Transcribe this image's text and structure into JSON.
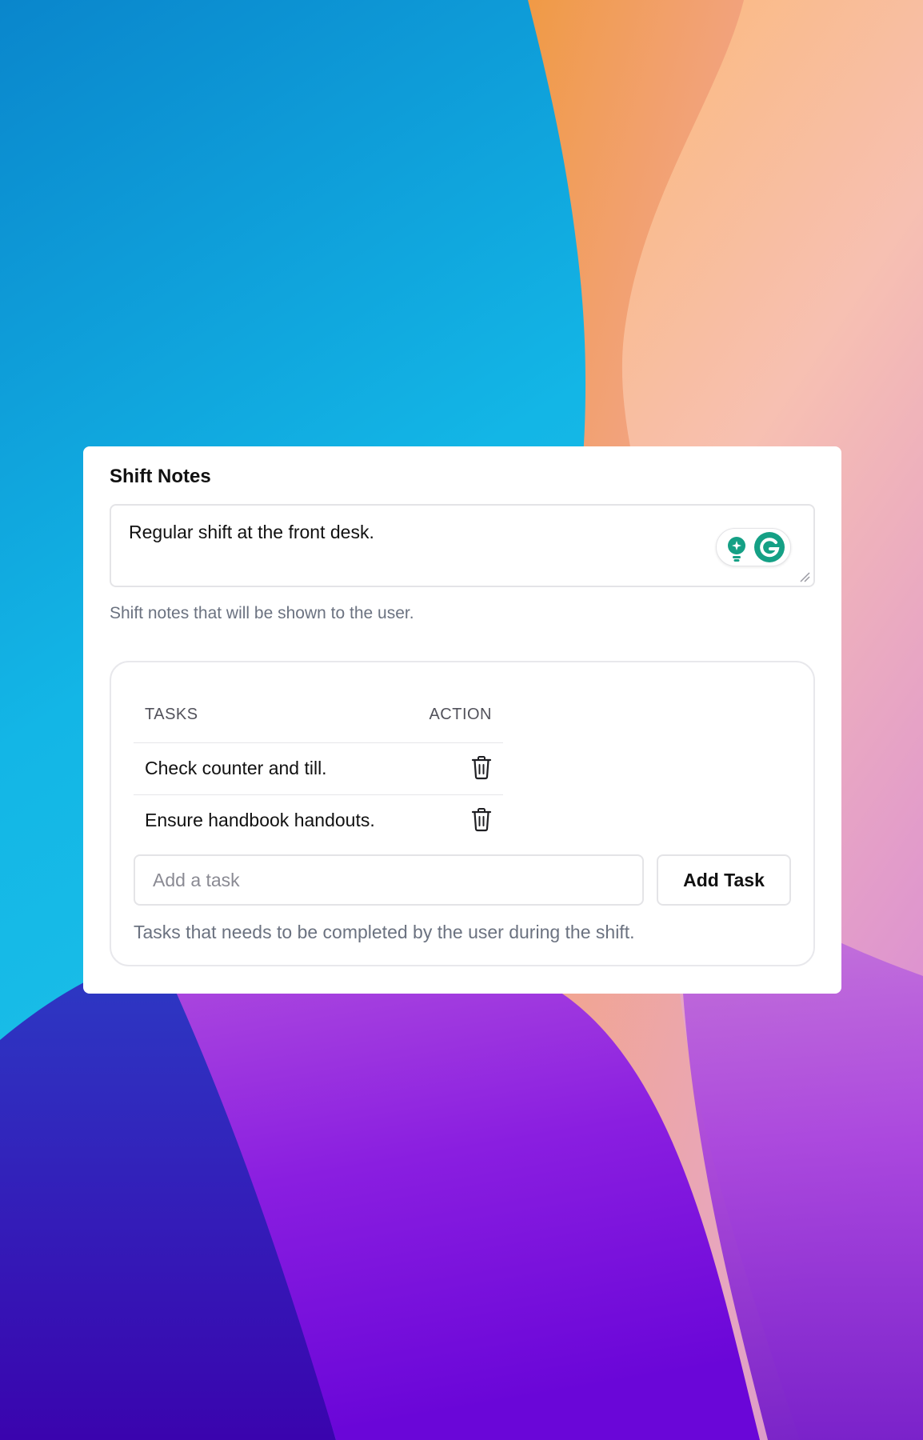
{
  "shift_notes": {
    "title": "Shift Notes",
    "value": "Regular shift at the front desk.",
    "hint": "Shift notes that will be shown to the user."
  },
  "tasks": {
    "header_tasks": "TASKS",
    "header_action": "ACTION",
    "items": [
      {
        "label": "Check counter and till."
      },
      {
        "label": "Ensure handbook handouts."
      }
    ],
    "input_placeholder": "Add a task",
    "add_button_label": "Add Task",
    "hint": "Tasks that needs to be completed by the user during the shift."
  },
  "icons": {
    "trash": "trash-icon",
    "grammarly": "grammarly-icon",
    "lightbulb": "lightbulb-icon"
  },
  "colors": {
    "grammarly_green": "#15a085",
    "card_bg": "#ffffff",
    "muted_text": "#6b7280"
  }
}
